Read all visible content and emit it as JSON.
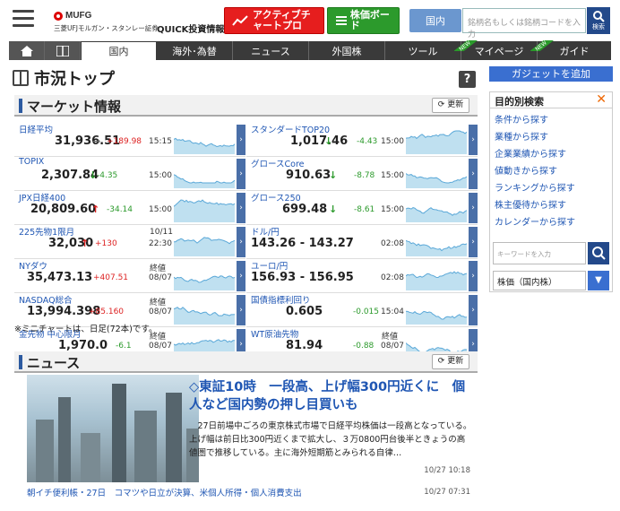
{
  "header": {
    "logo_mufg": "MUFG",
    "logo_sub": "三菱UFJモルガン・スタンレー証券",
    "app_name": "QUICK投資情報",
    "btn_active": "アクティブチャートプロ",
    "btn_board": "株価ボード",
    "btn_domestic": "国内",
    "search_placeholder": "銘柄名もしくは銘柄コードを入力",
    "search_label": "検索"
  },
  "nav": [
    {
      "label": "国内"
    },
    {
      "label": "海外･為替"
    },
    {
      "label": "ニュース"
    },
    {
      "label": "外国株"
    },
    {
      "label": "ツール"
    },
    {
      "label": "マイページ",
      "new": "NEW"
    },
    {
      "label": "ガイド",
      "new": "NEW"
    }
  ],
  "page_title": "市況トップ",
  "help": "?",
  "gadget": "ガジェットを追加",
  "market": {
    "title": "マーケット情報",
    "refresh": "更新",
    "note": "※ミニチャートは、日足(72本)です。",
    "items": [
      {
        "name": "日経平均",
        "price": "31,936.51",
        "dir": "flat",
        "change": "+189.98",
        "tone": "pos",
        "time": "15:15",
        "label": ""
      },
      {
        "name": "スタンダードTOP20",
        "price": "1,017.46",
        "dir": "down",
        "change": "-4.43",
        "tone": "neg",
        "time": "15:00",
        "label": ""
      },
      {
        "name": "TOPIX",
        "price": "2,307.84",
        "dir": "down",
        "change": "-4.35",
        "tone": "neg",
        "time": "15:00",
        "label": ""
      },
      {
        "name": "グロースCore",
        "price": "910.63",
        "dir": "down",
        "change": "-8.78",
        "tone": "neg",
        "time": "15:00",
        "label": ""
      },
      {
        "name": "JPX日経400",
        "price": "20,809.60",
        "dir": "up",
        "change": "-34.14",
        "tone": "neg",
        "time": "15:00",
        "label": ""
      },
      {
        "name": "グロース250",
        "price": "699.48",
        "dir": "down",
        "change": "-8.61",
        "tone": "neg",
        "time": "15:00",
        "label": ""
      },
      {
        "name": "225先物1限月",
        "price": "32,030",
        "dir": "up",
        "change": "+130",
        "tone": "pos",
        "time": "22:30",
        "label": "10/11"
      },
      {
        "name": "ドル/円",
        "price": "143.26 - 143.27",
        "dir": "",
        "change": "",
        "tone": "flat",
        "time": "02:08",
        "label": ""
      },
      {
        "name": "NYダウ",
        "price": "35,473.13",
        "dir": "",
        "change": "+407.51",
        "tone": "pos",
        "time": "08/07",
        "label": "終値"
      },
      {
        "name": "ユーロ/円",
        "price": "156.93 - 156.95",
        "dir": "",
        "change": "",
        "tone": "flat",
        "time": "02:08",
        "label": ""
      },
      {
        "name": "NASDAQ総合",
        "price": "13,994.398",
        "dir": "",
        "change": "+85.160",
        "tone": "pos",
        "time": "08/07",
        "label": "終値"
      },
      {
        "name": "国債指標利回り",
        "price": "0.605",
        "dir": "",
        "change": "-0.015",
        "tone": "neg",
        "time": "15:04",
        "label": ""
      },
      {
        "name": "金先物 中心限月",
        "price": "1,970.0",
        "dir": "",
        "change": "-6.1",
        "tone": "neg",
        "time": "08/07",
        "label": "終値"
      },
      {
        "name": "WT原油先物",
        "price": "81.94",
        "dir": "",
        "change": "-0.88",
        "tone": "neg",
        "time": "08/07",
        "label": "終値"
      }
    ]
  },
  "side": {
    "title": "目的別検索",
    "close": "✕",
    "links": [
      "条件から探す",
      "業種から探す",
      "企業業績から探す",
      "値動きから探す",
      "ランキングから探す",
      "株主優待から探す",
      "カレンダーから探す"
    ],
    "kw_placeholder": "キーワードを入力",
    "select_value": "株価（国内株）"
  },
  "news": {
    "title": "ニュース",
    "refresh": "更新",
    "headline": "◇東証10時　一段高、上げ幅300円近くに　個人など国内勢の押し目買いも",
    "body": "　27日前場中ごろの東京株式市場で日経平均株価は一段高となっている。上げ幅は前日比300円近くまで拡大し、３万0800円台後半ときょうの高値圏で推移している。主に海外短期筋とみられる自律…",
    "time": "10/27 10:18",
    "item2": "朝イチ便利帳・27日　コマツや日立が決算、米個人所得・個人消費支出",
    "item2_time": "10/27 07:31"
  },
  "colors": {
    "accent": "#2c5aa0",
    "link": "#1f56b3",
    "up": "#d22",
    "down": "#2c9a2c"
  }
}
